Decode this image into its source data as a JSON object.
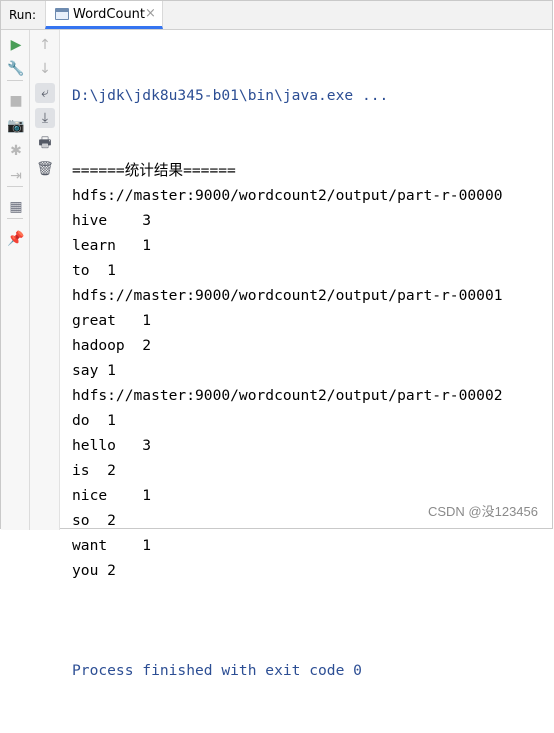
{
  "tabbar": {
    "run_label": "Run:",
    "tab_title": "WordCount",
    "close_glyph": "×"
  },
  "toolbar_left": [
    {
      "name": "rerun-icon",
      "glyph": "▶",
      "color": "#4a9d57"
    },
    {
      "name": "wrench-icon",
      "glyph": "🔧",
      "color": "#6c707e"
    },
    {
      "name": "stop-icon",
      "glyph": "■",
      "color": "#b8b8b8"
    },
    {
      "name": "camera-icon",
      "glyph": "📷",
      "color": "#b8b8b8"
    },
    {
      "name": "debug-icon",
      "glyph": "✱",
      "color": "#b8b8b8"
    },
    {
      "name": "exit-icon",
      "glyph": "⇥",
      "color": "#b8b8b8"
    },
    {
      "name": "layout-icon",
      "glyph": "▦",
      "color": "#6c707e"
    },
    {
      "name": "pin-icon",
      "glyph": "📌",
      "color": "#6c707e"
    }
  ],
  "toolbar_right": [
    {
      "name": "up-arrow-icon",
      "glyph": "↑"
    },
    {
      "name": "down-arrow-icon",
      "glyph": "↓"
    },
    {
      "name": "soft-wrap-icon",
      "glyph": "⤶"
    },
    {
      "name": "scroll-to-end-icon",
      "glyph": "⤓"
    },
    {
      "name": "print-icon",
      "glyph": "🖶"
    },
    {
      "name": "trash-icon",
      "glyph": "🗑"
    }
  ],
  "console": {
    "command": "D:\\jdk\\jdk8u345-b01\\bin\\java.exe ...",
    "lines": [
      "======统计结果======",
      "hdfs://master:9000/wordcount2/output/part-r-00000",
      "hive    3",
      "learn   1",
      "to  1",
      "hdfs://master:9000/wordcount2/output/part-r-00001",
      "great   1",
      "hadoop  2",
      "say 1",
      "hdfs://master:9000/wordcount2/output/part-r-00002",
      "do  1",
      "hello   3",
      "is  2",
      "nice    1",
      "so  2",
      "want    1",
      "you 2",
      ""
    ],
    "exit_message": "Process finished with exit code 0"
  },
  "watermark": "CSDN @没123456"
}
